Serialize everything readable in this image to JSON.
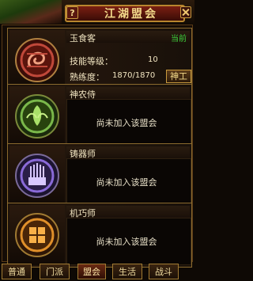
{
  "window": {
    "title": "江湖盟会",
    "help_label": "?"
  },
  "cards": [
    {
      "name": "玉食客",
      "current_tag": "当前",
      "skill_level_label": "技能等级：",
      "skill_level_value": "10",
      "proficiency_label": "熟练度：",
      "proficiency_value": "1870/1870",
      "action_label": "神工",
      "emblem": "dragon-emblem",
      "accent": "#c0483a"
    },
    {
      "name": "神农侍",
      "status": "尚未加入该盟会",
      "emblem": "leaf-emblem",
      "accent": "#7ab84a"
    },
    {
      "name": "铸器师",
      "status": "尚未加入该盟会",
      "emblem": "forge-emblem",
      "accent": "#8a6ad8"
    },
    {
      "name": "机巧师",
      "status": "尚未加入该盟会",
      "emblem": "gear-emblem",
      "accent": "#e0902a"
    }
  ],
  "tabs": [
    "普通",
    "门派",
    "盟会",
    "生活",
    "战斗"
  ],
  "active_tab": "盟会"
}
